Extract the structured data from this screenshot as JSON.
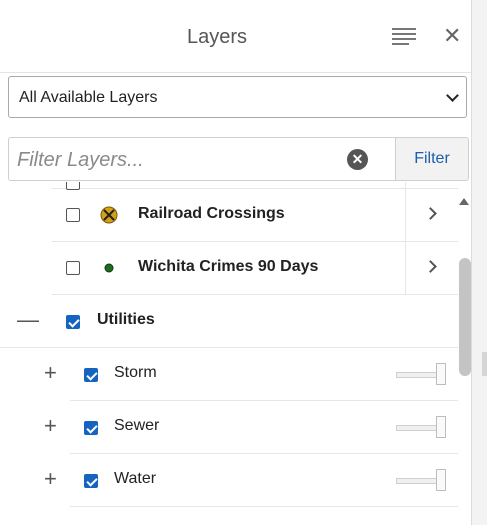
{
  "header": {
    "title": "Layers",
    "menu_icon": "hamburger-menu-icon",
    "close_icon": "close-icon"
  },
  "layer_select": {
    "value": "All Available Layers"
  },
  "filter": {
    "placeholder": "Filter Layers...",
    "button_label": "Filter"
  },
  "layers": [
    {
      "label": "Railroad Crossings",
      "checked": false,
      "icon": "railroad-crossing-icon"
    },
    {
      "label": "Wichita Crimes 90 Days",
      "checked": false,
      "icon": "dot-marker-icon"
    }
  ],
  "utilities": {
    "label": "Utilities",
    "checked": true,
    "expanded": true,
    "children": [
      {
        "label": "Storm",
        "checked": true,
        "opacity": 1
      },
      {
        "label": "Sewer",
        "checked": true,
        "opacity": 1
      },
      {
        "label": "Water",
        "checked": true,
        "opacity": 1
      }
    ]
  },
  "colors": {
    "accent": "#1565c0",
    "filter_text": "#1a5fa8",
    "railroad_yellow": "#d4a017",
    "crime_green": "#1f6b1f"
  }
}
